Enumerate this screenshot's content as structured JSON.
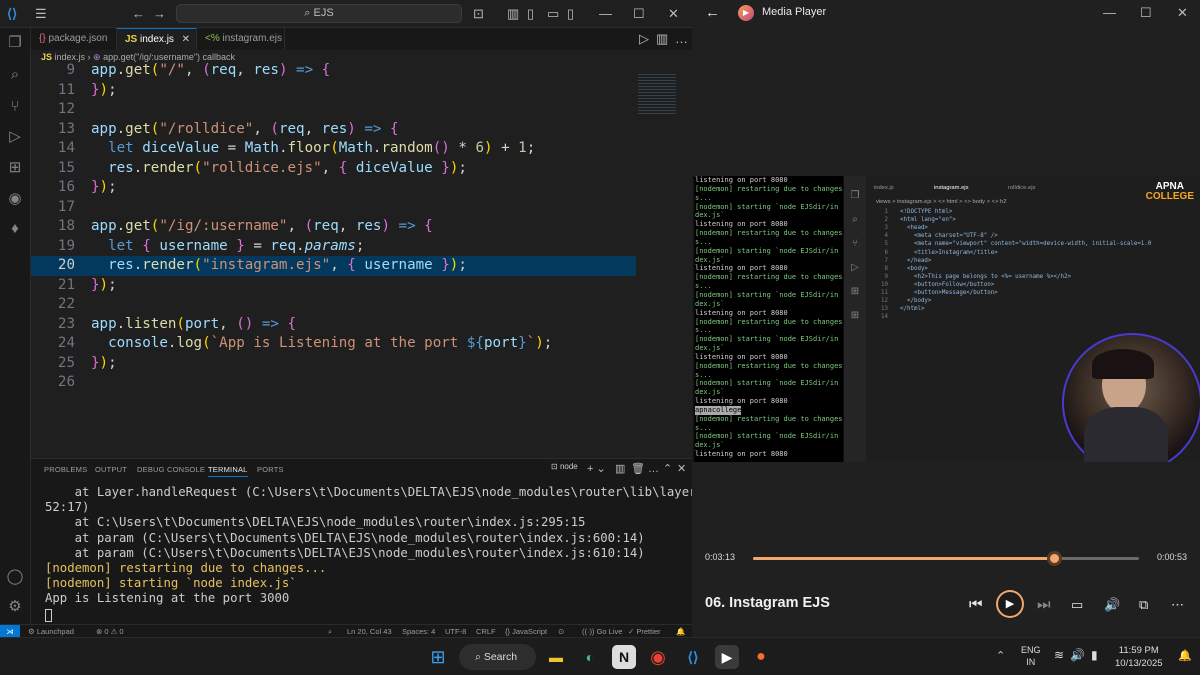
{
  "vscode": {
    "search_placeholder": "EJS",
    "tabs": [
      {
        "icon": "{}",
        "label": "package.json",
        "active": false
      },
      {
        "icon": "JS",
        "label": "index.js",
        "active": true
      },
      {
        "icon": "<%",
        "label": "instagram.ejs",
        "active": false
      }
    ],
    "breadcrumb": {
      "file": "index.js",
      "symbol": "app.get(\"/ig/:username\") callback"
    },
    "code_lines": [
      {
        "n": "9",
        "html": "<span class='var'>app</span><span class='wht'>.</span><span class='fn'>get</span><span class='pun'>(</span><span class='str'>\"/\"</span><span class='wht'>, </span><span class='par'>(</span><span class='var'>req</span><span class='wht'>, </span><span class='var'>res</span><span class='par'>)</span><span class='kw'> =&gt; </span><span class='par'>{</span>"
      },
      {
        "n": "11",
        "html": "<span class='par'>}</span><span class='pun'>)</span><span class='wht'>;</span>"
      },
      {
        "n": "12",
        "html": ""
      },
      {
        "n": "13",
        "html": "<span class='var'>app</span><span class='wht'>.</span><span class='fn'>get</span><span class='pun'>(</span><span class='str'>\"/rolldice\"</span><span class='wht'>, </span><span class='par'>(</span><span class='var'>req</span><span class='wht'>, </span><span class='var'>res</span><span class='par'>)</span><span class='kw'> =&gt; </span><span class='par'>{</span>"
      },
      {
        "n": "14",
        "html": "  <span class='kw'>let</span> <span class='var'>diceValue</span><span class='wht'> = </span><span class='var'>Math</span><span class='wht'>.</span><span class='fn'>floor</span><span class='pun'>(</span><span class='var'>Math</span><span class='wht'>.</span><span class='fn'>random</span><span class='par'>()</span><span class='wht'> * </span><span class='num'>6</span><span class='pun'>)</span><span class='wht'> + </span><span class='num'>1</span><span class='wht'>;</span>"
      },
      {
        "n": "15",
        "html": "  <span class='var'>res</span><span class='wht'>.</span><span class='fn'>render</span><span class='pun'>(</span><span class='str'>\"rolldice.ejs\"</span><span class='wht'>, </span><span class='par'>{</span><span class='var'> diceValue </span><span class='par'>}</span><span class='pun'>)</span><span class='wht'>;</span>"
      },
      {
        "n": "16",
        "html": "<span class='par'>}</span><span class='pun'>)</span><span class='wht'>;</span>"
      },
      {
        "n": "17",
        "html": ""
      },
      {
        "n": "18",
        "html": "<span class='var'>app</span><span class='wht'>.</span><span class='fn'>get</span><span class='pun'>(</span><span class='str'>\"/ig/:username\"</span><span class='wht'>, </span><span class='par'>(</span><span class='var'>req</span><span class='wht'>, </span><span class='var'>res</span><span class='par'>)</span><span class='kw'> =&gt; </span><span class='par'>{</span>"
      },
      {
        "n": "19",
        "html": "  <span class='kw'>let</span> <span class='par'>{</span><span class='var'> username </span><span class='par'>}</span><span class='wht'> = </span><span class='var'>req</span><span class='wht'>.</span><span class='var it'>params</span><span class='wht'>;</span>"
      },
      {
        "n": "20",
        "html": "  <span class='var'>res</span><span class='wht'>.</span><span class='fn'>render</span><span class='pun'>(</span><span class='str'>\"instagram.ejs\"</span><span class='wht'>, </span><span class='par'>{</span><span class='var'> username </span><span class='par'>}</span><span class='pun'>)</span><span class='wht'>;</span>",
        "current": true
      },
      {
        "n": "21",
        "html": "<span class='par'>}</span><span class='pun'>)</span><span class='wht'>;</span>"
      },
      {
        "n": "22",
        "html": ""
      },
      {
        "n": "23",
        "html": "<span class='var'>app</span><span class='wht'>.</span><span class='fn'>listen</span><span class='pun'>(</span><span class='var'>port</span><span class='wht'>, </span><span class='par'>()</span><span class='kw'> =&gt; </span><span class='par'>{</span>"
      },
      {
        "n": "24",
        "html": "  <span class='var'>console</span><span class='wht'>.</span><span class='fn'>log</span><span class='pun'>(</span><span class='str'>`App is Listening at the port </span><span class='kw'>${</span><span class='var'>port</span><span class='kw'>}</span><span class='str'>`</span><span class='pun'>)</span><span class='wht'>;</span>"
      },
      {
        "n": "25",
        "html": "<span class='par'>}</span><span class='pun'>)</span><span class='wht'>;</span>"
      },
      {
        "n": "26",
        "html": ""
      }
    ],
    "panel_tabs": [
      "PROBLEMS",
      "OUTPUT",
      "DEBUG CONSOLE",
      "TERMINAL",
      "PORTS"
    ],
    "terminal_name": "node",
    "terminal_lines": [
      {
        "text": "    at Layer.handleRequest (C:\\Users\\t\\Documents\\DELTA\\EJS\\node_modules\\router\\lib\\layer.js:1",
        "cls": ""
      },
      {
        "text": "52:17)",
        "cls": ""
      },
      {
        "text": "    at C:\\Users\\t\\Documents\\DELTA\\EJS\\node_modules\\router\\index.js:295:15",
        "cls": ""
      },
      {
        "text": "    at param (C:\\Users\\t\\Documents\\DELTA\\EJS\\node_modules\\router\\index.js:600:14)",
        "cls": ""
      },
      {
        "text": "    at param (C:\\Users\\t\\Documents\\DELTA\\EJS\\node_modules\\router\\index.js:610:14)",
        "cls": ""
      },
      {
        "text": "[nodemon] restarting due to changes...",
        "cls": "nod"
      },
      {
        "text": "[nodemon] starting `node index.js`",
        "cls": "nod"
      },
      {
        "text": "App is Listening at the port 3000",
        "cls": ""
      }
    ],
    "status": {
      "launchpad": "Launchpad",
      "problems": "⊗ 0 ⚠ 0",
      "position": "Ln 20, Col 43",
      "spaces": "Spaces: 4",
      "encoding": "UTF-8",
      "eol": "CRLF",
      "language": "{} JavaScript",
      "golive": "Go Live",
      "prettier": "✓ Prettier"
    }
  },
  "player": {
    "title": "Media Player",
    "elapsed": "0:03:13",
    "remaining": "0:00:53",
    "progress": 0.78,
    "video_title": "06. Instagram EJS",
    "video_terminal": [
      {
        "t": "listening on port 8080",
        "c": ""
      },
      {
        "t": "[nodemon] restarting due to changes",
        "c": "g"
      },
      {
        "t": "s...",
        "c": "g"
      },
      {
        "t": "[nodemon] starting `node EJSdir/in",
        "c": "g"
      },
      {
        "t": "dex.js`",
        "c": "g"
      },
      {
        "t": "listening on port 8080",
        "c": ""
      },
      {
        "t": "[nodemon] restarting due to changes",
        "c": "g"
      },
      {
        "t": "s...",
        "c": "g"
      },
      {
        "t": "[nodemon] starting `node EJSdir/in",
        "c": "g"
      },
      {
        "t": "dex.js`",
        "c": "g"
      },
      {
        "t": "listening on port 8080",
        "c": ""
      },
      {
        "t": "[nodemon] restarting due to changes",
        "c": "g"
      },
      {
        "t": "s...",
        "c": "g"
      },
      {
        "t": "[nodemon] starting `node EJSdir/in",
        "c": "g"
      },
      {
        "t": "dex.js`",
        "c": "g"
      },
      {
        "t": "listening on port 8080",
        "c": ""
      },
      {
        "t": "[nodemon] restarting due to changes",
        "c": "g"
      },
      {
        "t": "s...",
        "c": "g"
      },
      {
        "t": "[nodemon] starting `node EJSdir/in",
        "c": "g"
      },
      {
        "t": "dex.js`",
        "c": "g"
      },
      {
        "t": "listening on port 8080",
        "c": ""
      },
      {
        "t": "[nodemon] restarting due to changes",
        "c": "g"
      },
      {
        "t": "s...",
        "c": "g"
      },
      {
        "t": "[nodemon] starting `node EJSdir/in",
        "c": "g"
      },
      {
        "t": "dex.js`",
        "c": "g"
      },
      {
        "t": "listening on port 8080",
        "c": ""
      },
      {
        "t": "apnacollege",
        "c": "sel"
      },
      {
        "t": "[nodemon] restarting due to changes",
        "c": "g"
      },
      {
        "t": "s...",
        "c": "g"
      },
      {
        "t": "[nodemon] starting `node EJSdir/in",
        "c": "g"
      },
      {
        "t": "dex.js`",
        "c": "g"
      },
      {
        "t": "listening on port 8080",
        "c": ""
      }
    ],
    "inner_tabs": [
      "index.js",
      "instagram.ejs",
      "rolldice.ejs"
    ],
    "inner_breadcrumb": "views > instagram.ejs > <> html > <> body > <> h2",
    "inner_code": [
      {
        "n": "1",
        "t": "<!DOCTYPE html>"
      },
      {
        "n": "2",
        "t": "<html lang=\"en\">"
      },
      {
        "n": "3",
        "t": "  <head>"
      },
      {
        "n": "4",
        "t": "    <meta charset=\"UTF-8\" />"
      },
      {
        "n": "5",
        "t": "    <meta name=\"viewport\" content=\"width=device-width, initial-scale=1.0"
      },
      {
        "n": "6",
        "t": "    <title>Instagram</title>"
      },
      {
        "n": "7",
        "t": "  </head>"
      },
      {
        "n": "8",
        "t": "  <body>"
      },
      {
        "n": "9",
        "t": "    <h2>This page belongs to <%= username %></h2>"
      },
      {
        "n": "10",
        "t": "    <button>Follow</button>"
      },
      {
        "n": "11",
        "t": "    <button>Message</button>"
      },
      {
        "n": "12",
        "t": "  </body>"
      },
      {
        "n": "13",
        "t": "</html>"
      },
      {
        "n": "14",
        "t": ""
      }
    ],
    "logo_line1": "APNA",
    "logo_line2": "COLLEGE"
  },
  "taskbar": {
    "search": "Search",
    "lang1": "ENG",
    "lang2": "IN",
    "time": "11:59 PM",
    "date": "10/13/2025"
  },
  "colors": {
    "accent": "#0078d4",
    "progress": "#f1a86f",
    "brand": "#f5a623"
  }
}
